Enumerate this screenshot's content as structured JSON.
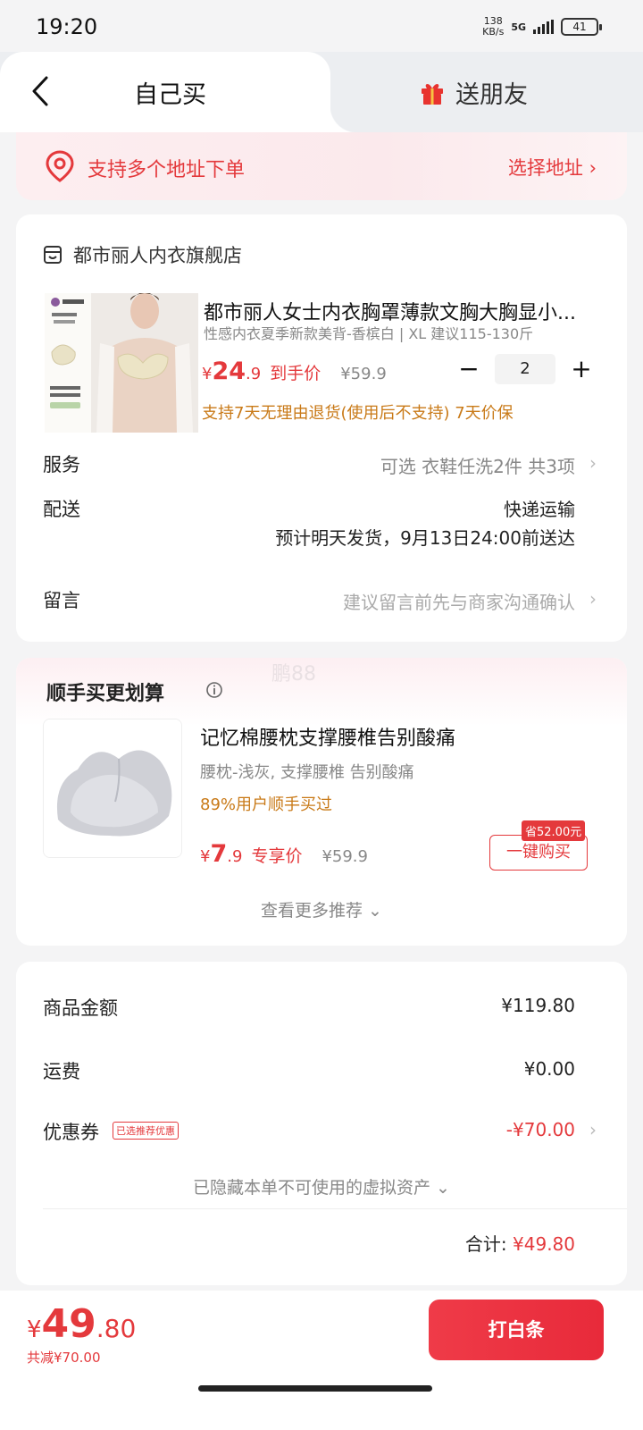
{
  "status": {
    "time": "19:20",
    "net_speed_value": "138",
    "net_speed_unit": "KB/s",
    "network": "5G",
    "battery": "41"
  },
  "tabs": {
    "self_buy": "自己买",
    "gift_friend": "送朋友"
  },
  "address": {
    "notice": "支持多个地址下单",
    "choose": "选择地址 ›"
  },
  "order": {
    "shop_name": "都市丽人内衣旗舰店",
    "product_title": "都市丽人女士内衣胸罩薄款文胸大胸显小...",
    "product_spec": "性感内衣夏季新款美背-香槟白 | XL 建议115-130斤",
    "price_yen": "¥",
    "price_int": "24",
    "price_dec": ".9",
    "price_label": "到手价",
    "orig_price": "¥59.9",
    "quantity": "2",
    "guarantee": "支持7天无理由退货(使用后不支持) 7天价保",
    "service_label": "服务",
    "service_value": "可选 衣鞋任洗2件 共3项",
    "delivery_label": "配送",
    "delivery_method": "快递运输",
    "delivery_eta": "预计明天发货，9月13日24:00前送达",
    "note_label": "留言",
    "note_placeholder": "建议留言前先与商家沟通确认"
  },
  "recommend": {
    "title": "顺手买更划算",
    "watermark": "鹏88",
    "item_title": "记忆棉腰枕支撑腰椎告别酸痛",
    "item_spec": "腰枕-浅灰, 支撑腰椎 告别酸痛",
    "item_social": "89%用户顺手买过",
    "price_yen": "¥",
    "price_int": "7",
    "price_dec": ".9",
    "price_label": "专享价",
    "orig_price": "¥59.9",
    "save_badge": "省52.00元",
    "buy_button": "一键购买",
    "more": "查看更多推荐 ⌄"
  },
  "summary": {
    "goods_label": "商品金额",
    "goods_value": "¥119.80",
    "shipping_label": "运费",
    "shipping_value": "¥0.00",
    "coupon_label": "优惠券",
    "coupon_tag": "已选推荐优惠",
    "coupon_value": "-¥70.00",
    "hidden_assets": "已隐藏本单不可使用的虚拟资产 ⌄",
    "total_label": "合计: ",
    "total_value": "¥49.80"
  },
  "pay": {
    "yen": "¥",
    "amount_int": "49",
    "amount_dec": ".80",
    "discount": "共减¥70.00",
    "button": "打白条"
  },
  "colors": {
    "accent": "#e4393c",
    "orange_text": "#c97a18",
    "background": "#f4f4f5"
  }
}
